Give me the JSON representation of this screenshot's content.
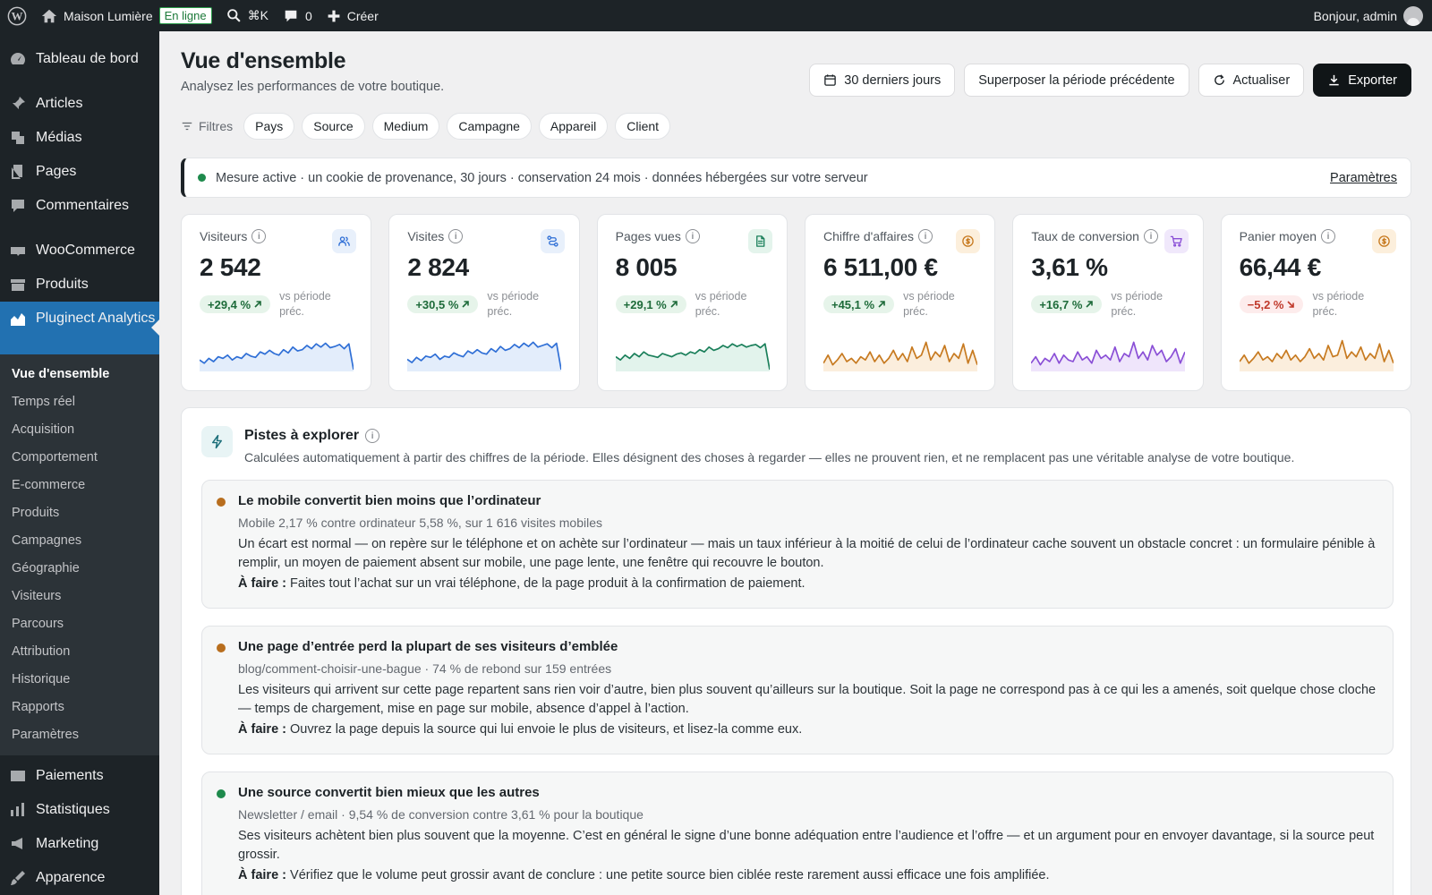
{
  "adminbar": {
    "site_name": "Maison Lumière",
    "status_badge": "En ligne",
    "search_shortcut": "⌘K",
    "comments_count": "0",
    "create_label": "Créer",
    "greeting": "Bonjour, admin"
  },
  "sidebar": {
    "items_top": [
      {
        "label": "Tableau de bord",
        "icon": "dashboard-icon"
      }
    ],
    "items_mid": [
      {
        "label": "Articles",
        "icon": "pin-icon"
      },
      {
        "label": "Médias",
        "icon": "media-icon"
      },
      {
        "label": "Pages",
        "icon": "pages-icon"
      },
      {
        "label": "Commentaires",
        "icon": "comment-icon"
      }
    ],
    "items_shop": [
      {
        "label": "WooCommerce",
        "icon": "woo-icon"
      },
      {
        "label": "Produits",
        "icon": "archive-icon"
      }
    ],
    "active_item": {
      "label": "Pluginect Analytics",
      "icon": "chart-area-icon"
    },
    "submenu": [
      "Vue d'ensemble",
      "Temps réel",
      "Acquisition",
      "Comportement",
      "E-commerce",
      "Produits",
      "Campagnes",
      "Géographie",
      "Visiteurs",
      "Parcours",
      "Attribution",
      "Historique",
      "Rapports",
      "Paramètres"
    ],
    "items_bottom": [
      {
        "label": "Paiements",
        "icon": "payments-icon"
      },
      {
        "label": "Statistiques",
        "icon": "stats-icon"
      },
      {
        "label": "Marketing",
        "icon": "megaphone-icon"
      },
      {
        "label": "Apparence",
        "icon": "brush-icon"
      }
    ]
  },
  "header": {
    "title": "Vue d'ensemble",
    "subtitle": "Analysez les performances de votre boutique.",
    "period_label": "30 derniers jours",
    "compare_label": "Superposer la période précédente",
    "refresh_label": "Actualiser",
    "export_label": "Exporter"
  },
  "filters": {
    "label": "Filtres",
    "chips": [
      "Pays",
      "Source",
      "Medium",
      "Campagne",
      "Appareil",
      "Client"
    ]
  },
  "notice": {
    "text": "Mesure active · un cookie de provenance, 30 jours · conservation 24 mois · données hébergées sur votre serveur",
    "link": "Paramètres"
  },
  "kpis": [
    {
      "label": "Visiteurs",
      "value": "2 542",
      "delta": "+29,4 %",
      "direction": "up",
      "vs": "vs période préc.",
      "color": "#2f6fd6",
      "fill": "#e3edfb",
      "icon": "users-icon",
      "icon_bg": "#e8f0fb",
      "series": [
        0.3,
        0.2,
        0.35,
        0.25,
        0.4,
        0.35,
        0.45,
        0.3,
        0.4,
        0.35,
        0.5,
        0.42,
        0.38,
        0.55,
        0.48,
        0.6,
        0.5,
        0.45,
        0.62,
        0.52,
        0.7,
        0.58,
        0.62,
        0.75,
        0.65,
        0.8,
        0.7,
        0.82,
        0.68,
        0.72,
        0.78,
        0.65,
        0.8,
        0.0
      ]
    },
    {
      "label": "Visites",
      "value": "2 824",
      "delta": "+30,5 %",
      "direction": "up",
      "vs": "vs période préc.",
      "color": "#2f6fd6",
      "fill": "#e3edfb",
      "icon": "route-icon",
      "icon_bg": "#e8f0fb",
      "series": [
        0.32,
        0.22,
        0.38,
        0.28,
        0.42,
        0.38,
        0.48,
        0.32,
        0.42,
        0.38,
        0.52,
        0.45,
        0.4,
        0.58,
        0.5,
        0.62,
        0.52,
        0.48,
        0.65,
        0.55,
        0.72,
        0.6,
        0.65,
        0.78,
        0.68,
        0.82,
        0.72,
        0.85,
        0.7,
        0.75,
        0.8,
        0.68,
        0.82,
        0.0
      ]
    },
    {
      "label": "Pages vues",
      "value": "8 005",
      "delta": "+29,1 %",
      "direction": "up",
      "vs": "vs période préc.",
      "color": "#1a7f5a",
      "fill": "#e2f3ec",
      "icon": "document-icon",
      "icon_bg": "#e4f4ec",
      "series": [
        0.4,
        0.3,
        0.45,
        0.35,
        0.5,
        0.4,
        0.55,
        0.45,
        0.42,
        0.38,
        0.5,
        0.45,
        0.4,
        0.48,
        0.52,
        0.45,
        0.55,
        0.5,
        0.62,
        0.55,
        0.7,
        0.6,
        0.65,
        0.75,
        0.68,
        0.8,
        0.72,
        0.78,
        0.7,
        0.75,
        0.78,
        0.68,
        0.8,
        0.0
      ]
    },
    {
      "label": "Chiffre d'affaires",
      "value": "6 511,00 €",
      "delta": "+45,1 %",
      "direction": "up",
      "vs": "vs période préc.",
      "color": "#c77a20",
      "fill": "#fbeedd",
      "icon": "coin-icon",
      "icon_bg": "#fcefdc",
      "series": [
        0.2,
        0.45,
        0.15,
        0.3,
        0.5,
        0.25,
        0.35,
        0.2,
        0.4,
        0.3,
        0.55,
        0.25,
        0.45,
        0.2,
        0.35,
        0.6,
        0.3,
        0.5,
        0.25,
        0.7,
        0.35,
        0.45,
        0.85,
        0.3,
        0.55,
        0.4,
        0.75,
        0.25,
        0.5,
        0.35,
        0.8,
        0.2,
        0.6,
        0.15
      ]
    },
    {
      "label": "Taux de conversion",
      "value": "3,61 %",
      "delta": "+16,7 %",
      "direction": "up",
      "vs": "vs période préc.",
      "color": "#8a4fd6",
      "fill": "#efe5fb",
      "icon": "cart-icon",
      "icon_bg": "#f0e8fb",
      "series": [
        0.2,
        0.4,
        0.15,
        0.35,
        0.25,
        0.5,
        0.2,
        0.45,
        0.3,
        0.25,
        0.55,
        0.3,
        0.4,
        0.2,
        0.6,
        0.35,
        0.45,
        0.3,
        0.7,
        0.25,
        0.5,
        0.4,
        0.85,
        0.35,
        0.55,
        0.3,
        0.75,
        0.45,
        0.6,
        0.25,
        0.4,
        0.65,
        0.2,
        0.55
      ]
    },
    {
      "label": "Panier moyen",
      "value": "66,44 €",
      "delta": "−5,2 %",
      "direction": "down",
      "vs": "vs période préc.",
      "color": "#c77a20",
      "fill": "#fbeedd",
      "icon": "coin-icon",
      "icon_bg": "#fcefdc",
      "series": [
        0.25,
        0.45,
        0.2,
        0.35,
        0.55,
        0.3,
        0.4,
        0.25,
        0.5,
        0.35,
        0.6,
        0.3,
        0.45,
        0.25,
        0.4,
        0.65,
        0.35,
        0.5,
        0.3,
        0.75,
        0.4,
        0.45,
        0.9,
        0.35,
        0.55,
        0.4,
        0.7,
        0.3,
        0.5,
        0.35,
        0.8,
        0.25,
        0.6,
        0.2
      ]
    }
  ],
  "insights": {
    "title": "Pistes à explorer",
    "subtitle": "Calculées automatiquement à partir des chiffres de la période. Elles désignent des choses à regarder — elles ne prouvent rien, et ne remplacent pas une véritable analyse de votre boutique.",
    "todo_label": "À faire :",
    "items": [
      {
        "title": "Le mobile convertit bien moins que l’ordinateur",
        "meta": "Mobile 2,17 % contre ordinateur 5,58 %, sur 1 616 visites mobiles",
        "body": "Un écart est normal — on repère sur le téléphone et on achète sur l’ordinateur — mais un taux inférieur à la moitié de celui de l’ordinateur cache souvent un obstacle concret : un formulaire pénible à remplir, un moyen de paiement absent sur mobile, une page lente, une fenêtre qui recouvre le bouton.",
        "todo": "Faites tout l’achat sur un vrai téléphone, de la page produit à la confirmation de paiement.",
        "color": "#b86e1e"
      },
      {
        "title": "Une page d’entrée perd la plupart de ses visiteurs d’emblée",
        "meta": "blog/comment-choisir-une-bague · 74 % de rebond sur 159 entrées",
        "body": "Les visiteurs qui arrivent sur cette page repartent sans rien voir d’autre, bien plus souvent qu’ailleurs sur la boutique. Soit la page ne correspond pas à ce qui les a amenés, soit quelque chose cloche — temps de chargement, mise en page sur mobile, absence d’appel à l’action.",
        "todo": "Ouvrez la page depuis la source qui lui envoie le plus de visiteurs, et lisez-la comme eux.",
        "color": "#b86e1e"
      },
      {
        "title": "Une source convertit bien mieux que les autres",
        "meta": "Newsletter / email · 9,54 % de conversion contre 3,61 % pour la boutique",
        "body": "Ses visiteurs achètent bien plus souvent que la moyenne. C’est en général le signe d’une bonne adéquation entre l’audience et l’offre — et un argument pour en envoyer davantage, si la source peut grossir.",
        "todo": "Vérifiez que le volume peut grossir avant de conclure : une petite source bien ciblée reste rarement aussi efficace une fois amplifiée.",
        "color": "#1e8a4c"
      }
    ]
  }
}
